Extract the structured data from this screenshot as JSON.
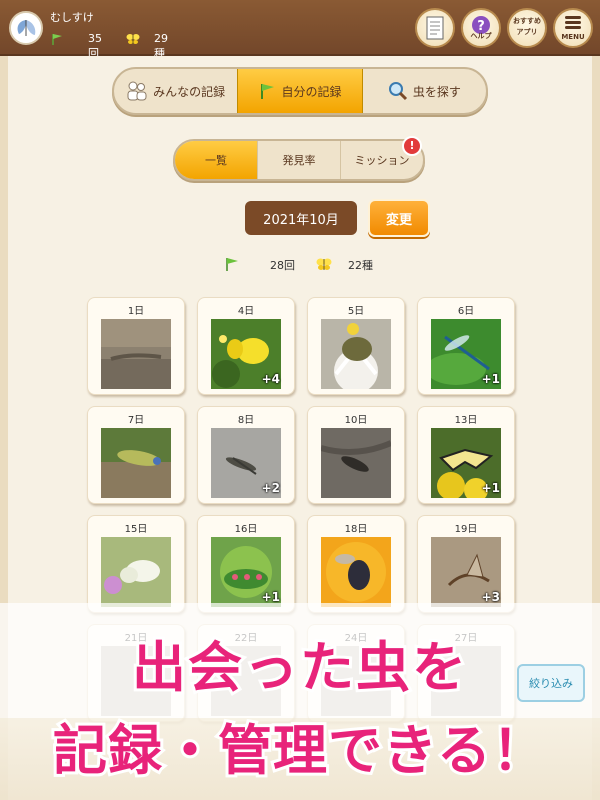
{
  "header": {
    "username": "むしすけ",
    "visits": "35回",
    "species": "29種",
    "buttons": [
      {
        "label": "",
        "icon": "notepad-icon"
      },
      {
        "label": "ヘルプ",
        "icon": "question-icon"
      },
      {
        "label": "おすすめアプリ",
        "icon": "none"
      },
      {
        "label": "MENU",
        "icon": "menu-icon"
      }
    ]
  },
  "main_tabs": [
    {
      "label": "みんなの記録",
      "icon": "people-icon"
    },
    {
      "label": "自分の記録",
      "icon": "flag-icon",
      "active": true
    },
    {
      "label": "虫を探す",
      "icon": "magnifier-icon"
    }
  ],
  "sub_tabs": [
    {
      "label": "一覧",
      "active": true
    },
    {
      "label": "発見率"
    },
    {
      "label": "ミッション"
    }
  ],
  "badge": "!",
  "month": {
    "current": "2021年10月",
    "change_label": "変更"
  },
  "totals": {
    "visits": "28回",
    "species": "22種"
  },
  "days": [
    {
      "day": "1日",
      "more": "",
      "photo": "lizard"
    },
    {
      "day": "4日",
      "more": "+4",
      "photo": "yellow-butterfly"
    },
    {
      "day": "5日",
      "more": "",
      "photo": "beetle-on-flower"
    },
    {
      "day": "6日",
      "more": "+1",
      "photo": "dragonfly"
    },
    {
      "day": "7日",
      "more": "",
      "photo": "moth-on-leaf"
    },
    {
      "day": "8日",
      "more": "+2",
      "photo": "grasshopper-on-rock"
    },
    {
      "day": "10日",
      "more": "",
      "photo": "insect-on-bark"
    },
    {
      "day": "13日",
      "more": "+1",
      "photo": "swallowtail"
    },
    {
      "day": "15日",
      "more": "",
      "photo": "white-butterfly"
    },
    {
      "day": "16日",
      "more": "+1",
      "photo": "caterpillar"
    },
    {
      "day": "18日",
      "more": "",
      "photo": "fly-on-flower"
    },
    {
      "day": "19日",
      "more": "+3",
      "photo": "mayfly"
    },
    {
      "day": "21日",
      "more": "",
      "photo": "faded"
    },
    {
      "day": "22日",
      "more": "",
      "photo": "faded"
    },
    {
      "day": "24日",
      "more": "",
      "photo": "faded"
    },
    {
      "day": "27日",
      "more": "",
      "photo": "faded"
    }
  ],
  "filter_label": "絞り込み",
  "caption": {
    "line1": "出会った虫を",
    "line2": "記録・管理できる！"
  },
  "colors": {
    "accent": "#f3a400",
    "header": "#73472a",
    "caption": "#e8237a"
  }
}
